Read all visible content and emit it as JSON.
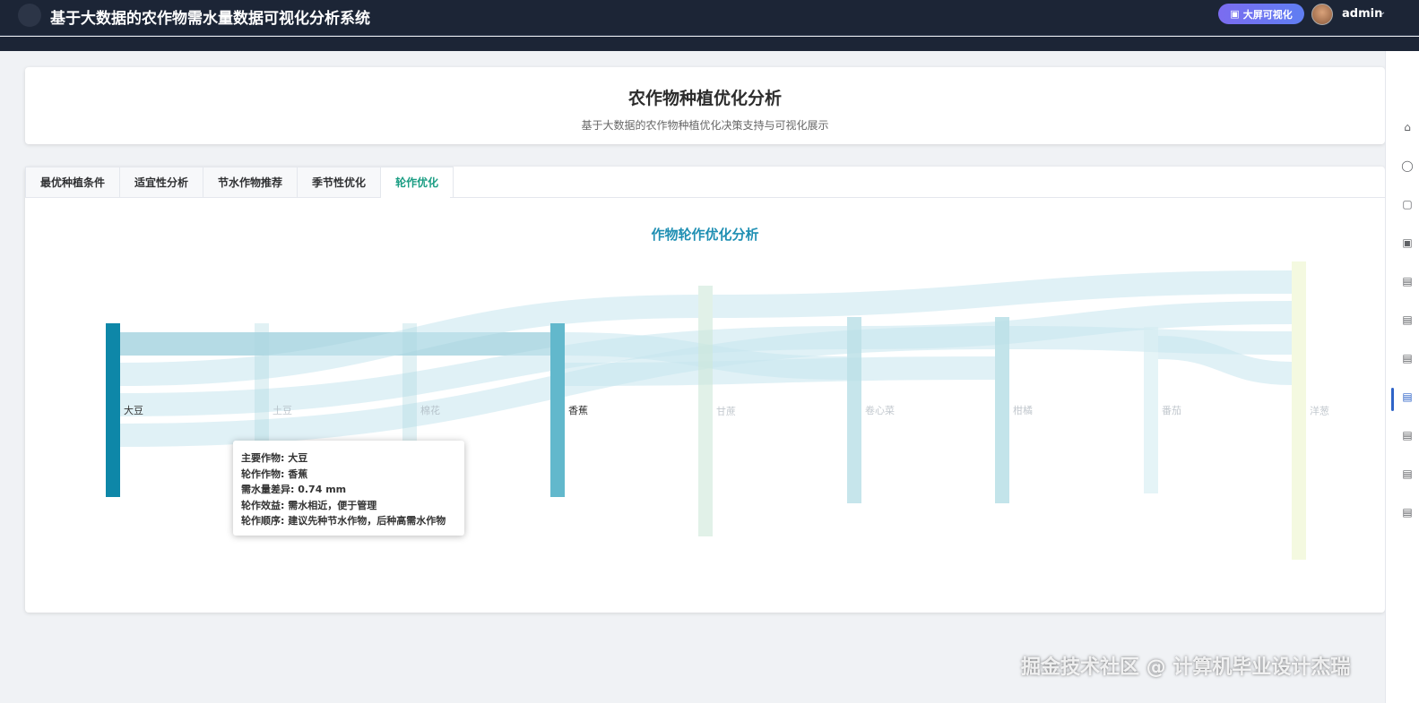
{
  "app": {
    "title": "基于大数据的农作物需水量数据可视化分析系统",
    "bigscreen_label": "大屏可视化",
    "user_name": "admin"
  },
  "header": {
    "title": "农作物种植优化分析",
    "subtitle": "基于大数据的农作物种植优化决策支持与可视化展示"
  },
  "tabs": [
    {
      "label": "最优种植条件",
      "active": false
    },
    {
      "label": "适宜性分析",
      "active": false
    },
    {
      "label": "节水作物推荐",
      "active": false
    },
    {
      "label": "季节性优化",
      "active": false
    },
    {
      "label": "轮作优化",
      "active": true
    }
  ],
  "chart_data": {
    "type": "sankey",
    "title": "作物轮作优化分析",
    "nodes": [
      {
        "name": "大豆",
        "color": "#0e87a8",
        "opacity": 1.0
      },
      {
        "name": "土豆",
        "color": "#a8d8e0",
        "opacity": 0.35
      },
      {
        "name": "棉花",
        "color": "#a8d8e0",
        "opacity": 0.35
      },
      {
        "name": "香蕉",
        "color": "#62b8cc",
        "opacity": 1.0
      },
      {
        "name": "甘蔗",
        "color": "#cde8d8",
        "opacity": 0.6
      },
      {
        "name": "卷心菜",
        "color": "#b8dfe6",
        "opacity": 0.8
      },
      {
        "name": "柑橘",
        "color": "#b8dfe6",
        "opacity": 0.85
      },
      {
        "name": "番茄",
        "color": "#d3ecf1",
        "opacity": 0.6
      },
      {
        "name": "洋葱",
        "color": "#f1f8d8",
        "opacity": 0.8
      }
    ],
    "links": [
      {
        "source": "大豆",
        "target": "香蕉",
        "diff": 0.74
      },
      {
        "source": "大豆",
        "target": "甘蔗"
      },
      {
        "source": "大豆",
        "target": "卷心菜"
      },
      {
        "source": "大豆",
        "target": "柑橘"
      },
      {
        "source": "香蕉",
        "target": "卷心菜"
      },
      {
        "source": "香蕉",
        "target": "柑橘"
      },
      {
        "source": "甘蔗",
        "target": "洋葱"
      },
      {
        "source": "卷心菜",
        "target": "洋葱"
      },
      {
        "source": "柑橘",
        "target": "洋葱"
      },
      {
        "source": "番茄",
        "target": "洋葱"
      }
    ],
    "tooltip": {
      "lines": [
        "主要作物: 大豆",
        "轮作作物: 香蕉",
        "需水量差异: 0.74 mm",
        "轮作效益: 需水相近，便于管理",
        "轮作顺序: 建议先种节水作物，后种高需水作物"
      ]
    }
  },
  "watermark": "掘金技术社区 @ 计算机毕业设计杰瑞"
}
